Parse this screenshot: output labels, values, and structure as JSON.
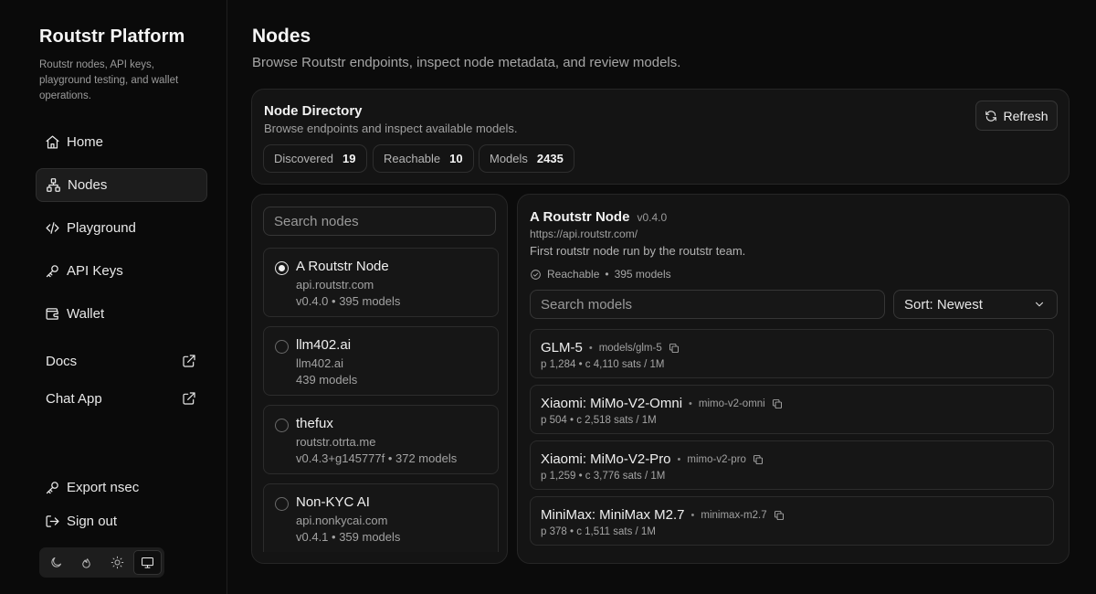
{
  "sidebar": {
    "brand": "Routstr Platform",
    "subtitle": "Routstr nodes, API keys, playground testing, and wallet operations.",
    "nav": [
      {
        "label": "Home",
        "icon": "home-icon"
      },
      {
        "label": "Nodes",
        "icon": "network-icon",
        "active": true
      },
      {
        "label": "Playground",
        "icon": "code-icon"
      },
      {
        "label": "API Keys",
        "icon": "key-icon"
      },
      {
        "label": "Wallet",
        "icon": "wallet-icon"
      }
    ],
    "links": [
      {
        "label": "Docs",
        "icon": "external-link-icon"
      },
      {
        "label": "Chat App",
        "icon": "external-link-icon"
      }
    ],
    "bottom": [
      {
        "label": "Export nsec",
        "icon": "key-icon"
      },
      {
        "label": "Sign out",
        "icon": "sign-out-icon"
      }
    ],
    "theme": {
      "options": [
        "moon-icon",
        "flame-icon",
        "sun-icon",
        "monitor-icon"
      ],
      "selected": "monitor-icon"
    }
  },
  "page": {
    "title": "Nodes",
    "subtitle": "Browse Routstr endpoints, inspect node metadata, and review models."
  },
  "directory": {
    "title": "Node Directory",
    "subtitle": "Browse endpoints and inspect available models.",
    "refresh_label": "Refresh",
    "stats": [
      {
        "label": "Discovered",
        "value": "19"
      },
      {
        "label": "Reachable",
        "value": "10"
      },
      {
        "label": "Models",
        "value": "2435"
      }
    ]
  },
  "node_list": {
    "search_placeholder": "Search nodes",
    "items": [
      {
        "name": "A Routstr Node",
        "host": "api.routstr.com",
        "meta": "v0.4.0 • 395 models",
        "selected": true
      },
      {
        "name": "llm402.ai",
        "host": "llm402.ai",
        "meta": "439 models",
        "selected": false
      },
      {
        "name": "thefux",
        "host": "routstr.otrta.me",
        "meta": "v0.4.3+g145777f • 372 models",
        "selected": false
      },
      {
        "name": "Non-KYC AI",
        "host": "api.nonkycai.com",
        "meta": "v0.4.1 • 359 models",
        "selected": false
      }
    ]
  },
  "detail": {
    "name": "A Routstr Node",
    "version": "v0.4.0",
    "url": "https://api.routstr.com/",
    "description": "First routstr node run by the routstr team.",
    "status": "Reachable",
    "model_count": "395 models",
    "search_placeholder": "Search models",
    "sort_label": "Sort: Newest",
    "models": [
      {
        "name": "GLM-5",
        "id": "models/glm-5",
        "price": "p 1,284 • c 4,110 sats / 1M"
      },
      {
        "name": "Xiaomi: MiMo-V2-Omni",
        "id": "mimo-v2-omni",
        "price": "p 504 • c 2,518 sats / 1M"
      },
      {
        "name": "Xiaomi: MiMo-V2-Pro",
        "id": "mimo-v2-pro",
        "price": "p 1,259 • c 3,776 sats / 1M"
      },
      {
        "name": "MiniMax: MiniMax M2.7",
        "id": "minimax-m2.7",
        "price": "p 378 • c 1,511 sats / 1M"
      }
    ]
  },
  "colors": {
    "background": "#0b0b0b",
    "card": "#141414",
    "border": "#262626",
    "text": "#ededed",
    "muted": "#a0a0a0"
  }
}
